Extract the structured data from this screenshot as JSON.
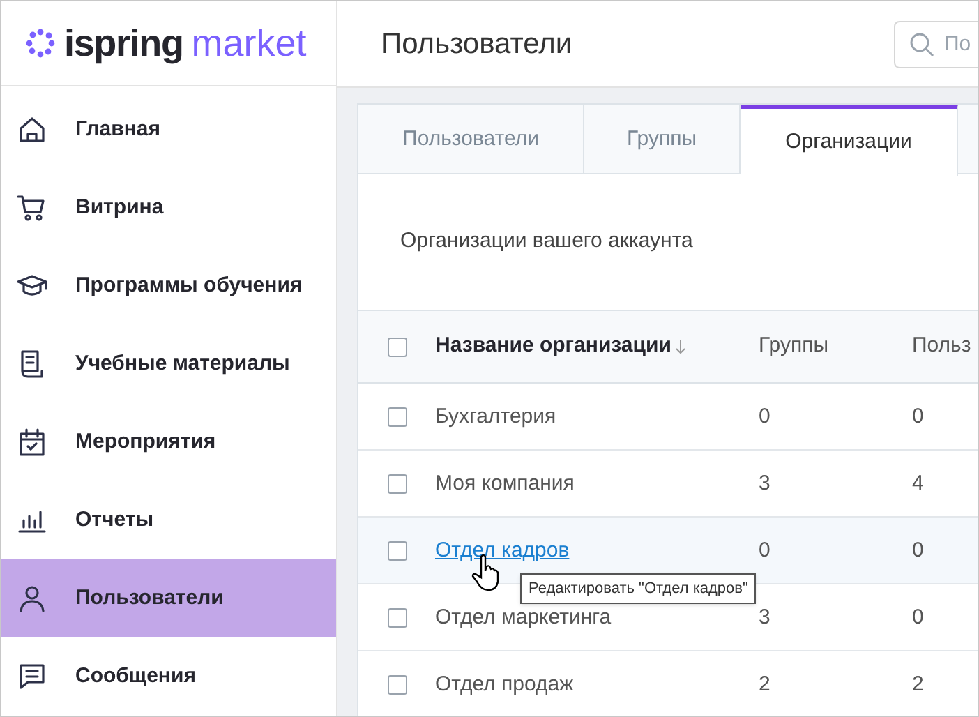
{
  "logo": {
    "word_1": "ispring",
    "word_2": "market"
  },
  "sidebar": {
    "items": [
      {
        "label": "Главная",
        "kind": "home",
        "selected": false
      },
      {
        "label": "Витрина",
        "kind": "cart",
        "selected": false
      },
      {
        "label": "Программы обучения",
        "kind": "cap",
        "selected": false
      },
      {
        "label": "Учебные материалы",
        "kind": "doc",
        "selected": false
      },
      {
        "label": "Мероприятия",
        "kind": "calendar",
        "selected": false
      },
      {
        "label": "Отчеты",
        "kind": "chart",
        "selected": false
      },
      {
        "label": "Пользователи",
        "kind": "user",
        "selected": true
      },
      {
        "label": "Сообщения",
        "kind": "message",
        "selected": false
      }
    ]
  },
  "header": {
    "title": "Пользователи",
    "search": {
      "placeholder": "По"
    }
  },
  "tabs": [
    {
      "label": "Пользователи",
      "selected": false
    },
    {
      "label": "Группы",
      "selected": false
    },
    {
      "label": "Организации",
      "selected": true
    }
  ],
  "section_title": "Организации вашего аккаунта",
  "table": {
    "columns": [
      {
        "label": "Название организации",
        "sorted": true
      },
      {
        "label": "Группы",
        "sorted": false
      },
      {
        "label": "Польз",
        "sorted": false
      }
    ],
    "header_checked": false,
    "rows": [
      {
        "name": "Бухгалтерия",
        "groups": "0",
        "users": "0",
        "checked": false,
        "hovered": false
      },
      {
        "name": "Моя компания",
        "groups": "3",
        "users": "4",
        "checked": false,
        "hovered": false
      },
      {
        "name": "Отдел кадров",
        "groups": "0",
        "users": "0",
        "checked": false,
        "hovered": true
      },
      {
        "name": "Отдел маркетинга",
        "groups": "3",
        "users": "0",
        "checked": false,
        "hovered": false
      },
      {
        "name": "Отдел продаж",
        "groups": "2",
        "users": "2",
        "checked": false,
        "hovered": false
      }
    ]
  },
  "tooltip": "Редактировать \"Отдел кадров\""
}
